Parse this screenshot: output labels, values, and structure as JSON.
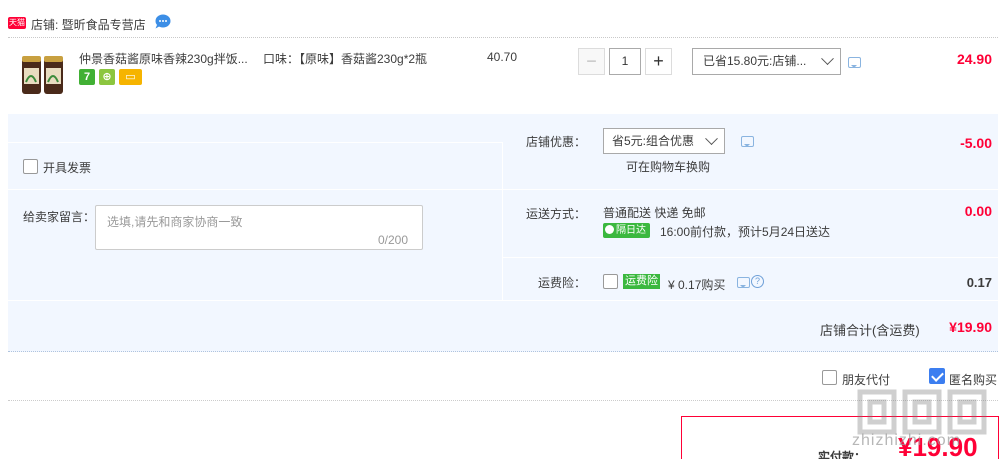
{
  "shop": {
    "badge": "天猫",
    "label": "店铺: 暨昕食品专营店"
  },
  "item": {
    "title": "仲景香菇酱原味香辣230g拌饭...",
    "sku": "口味：【原味】香菇酱230g*2瓶",
    "unit_price": "40.70",
    "quantity": "1",
    "minus": "−",
    "plus": "+",
    "saved_label": "已省15.80元:店铺...",
    "total": "24.90"
  },
  "invoice": {
    "label": "开具发票"
  },
  "remark": {
    "label": "给卖家留言：",
    "placeholder": "选填,请先和商家协商一致",
    "count": "0/200"
  },
  "discount": {
    "label": "店铺优惠：",
    "selected": "省5元:组合优惠",
    "note": "可在购物车换购",
    "amount": "-5.00"
  },
  "shipping": {
    "label": "运送方式：",
    "method": "普通配送 快递 免邮",
    "badge": "隔日达",
    "time": "16:00前付款，预计5月24日送达",
    "amount": "0.00"
  },
  "insurance": {
    "label": "运费险：",
    "badge": "运费险",
    "text": "¥ 0.17购买",
    "help": "?",
    "amount": "0.17"
  },
  "subtotal": {
    "label": "店铺合计(含运费)",
    "amount": "¥19.90"
  },
  "options": {
    "friend_pay": "朋友代付",
    "anonymous": "匿名购买"
  },
  "pay": {
    "label": "实付款：",
    "amount": "¥19.90"
  },
  "watermark": {
    "url": "zhizhizhi.com"
  },
  "colors": {
    "accent": "#ff0036",
    "panel_bg": "#f2f7ff",
    "green_badge": "#3bb83f"
  }
}
